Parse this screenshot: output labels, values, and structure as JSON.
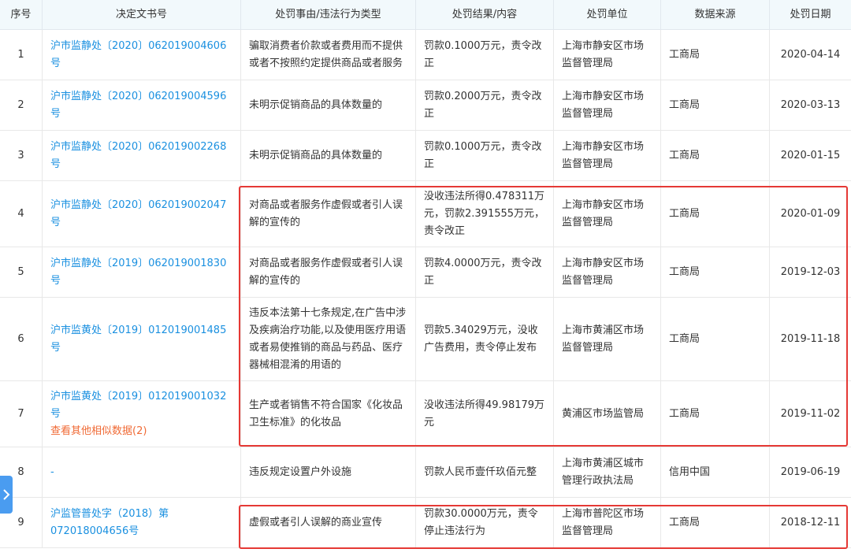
{
  "columns": {
    "seq": "序号",
    "doc": "决定文书号",
    "reason": "处罚事由/违法行为类型",
    "result": "处罚结果/内容",
    "unit": "处罚单位",
    "source": "数据来源",
    "date": "处罚日期"
  },
  "rows": [
    {
      "seq": "1",
      "doc": "沪市监静处〔2020〕062019004606号",
      "reason": "骗取消费者价款或者费用而不提供或者不按照约定提供商品或者服务",
      "result": "罚款0.1000万元，责令改正",
      "unit": "上海市静安区市场监督管理局",
      "source": "工商局",
      "date": "2020-04-14"
    },
    {
      "seq": "2",
      "doc": "沪市监静处〔2020〕062019004596号",
      "reason": "未明示促销商品的具体数量的",
      "result": "罚款0.2000万元，责令改正",
      "unit": "上海市静安区市场监督管理局",
      "source": "工商局",
      "date": "2020-03-13"
    },
    {
      "seq": "3",
      "doc": "沪市监静处〔2020〕062019002268号",
      "reason": "未明示促销商品的具体数量的",
      "result": "罚款0.1000万元，责令改正",
      "unit": "上海市静安区市场监督管理局",
      "source": "工商局",
      "date": "2020-01-15"
    },
    {
      "seq": "4",
      "doc": "沪市监静处〔2020〕062019002047号",
      "reason": "对商品或者服务作虚假或者引人误解的宣传的",
      "result": "没收违法所得0.478311万元，罚款2.391555万元，责令改正",
      "unit": "上海市静安区市场监督管理局",
      "source": "工商局",
      "date": "2020-01-09"
    },
    {
      "seq": "5",
      "doc": "沪市监静处〔2019〕062019001830号",
      "reason": "对商品或者服务作虚假或者引人误解的宣传的",
      "result": "罚款4.0000万元，责令改正",
      "unit": "上海市静安区市场监督管理局",
      "source": "工商局",
      "date": "2019-12-03"
    },
    {
      "seq": "6",
      "doc": "沪市监黄处〔2019〕012019001485号",
      "reason": "违反本法第十七条规定,在广告中涉及疾病治疗功能,以及使用医疗用语或者易使推销的商品与药品、医疗器械相混淆的用语的",
      "result": "罚款5.34029万元，没收广告费用，责令停止发布",
      "unit": "上海市黄浦区市场监督管理局",
      "source": "工商局",
      "date": "2019-11-18"
    },
    {
      "seq": "7",
      "doc": "沪市监黄处〔2019〕012019001032号",
      "more": "查看其他相似数据(2)",
      "reason": "生产或者销售不符合国家《化妆品卫生标准》的化妆品",
      "result": "没收违法所得49.98179万元",
      "unit": "黄浦区市场监管局",
      "source": "工商局",
      "date": "2019-11-02"
    },
    {
      "seq": "8",
      "doc": "-",
      "reason": "违反规定设置户外设施",
      "result": "罚款人民币壹仟玖佰元整",
      "unit": "上海市黄浦区城市管理行政执法局",
      "source": "信用中国",
      "date": "2019-06-19"
    },
    {
      "seq": "9",
      "doc": "沪监管普处字（2018）第072018004656号",
      "reason": "虚假或者引人误解的商业宣传",
      "result": "罚款30.0000万元，责令停止违法行为",
      "unit": "上海市普陀区市场监督管理局",
      "source": "工商局",
      "date": "2018-12-11"
    }
  ],
  "colors": {
    "link": "#1a90e0",
    "more_link": "#f06a35",
    "highlight_box": "#e53935",
    "header_bg": "#f2f9fc"
  },
  "icons": {
    "side_toggle": "chevron-right-icon"
  }
}
